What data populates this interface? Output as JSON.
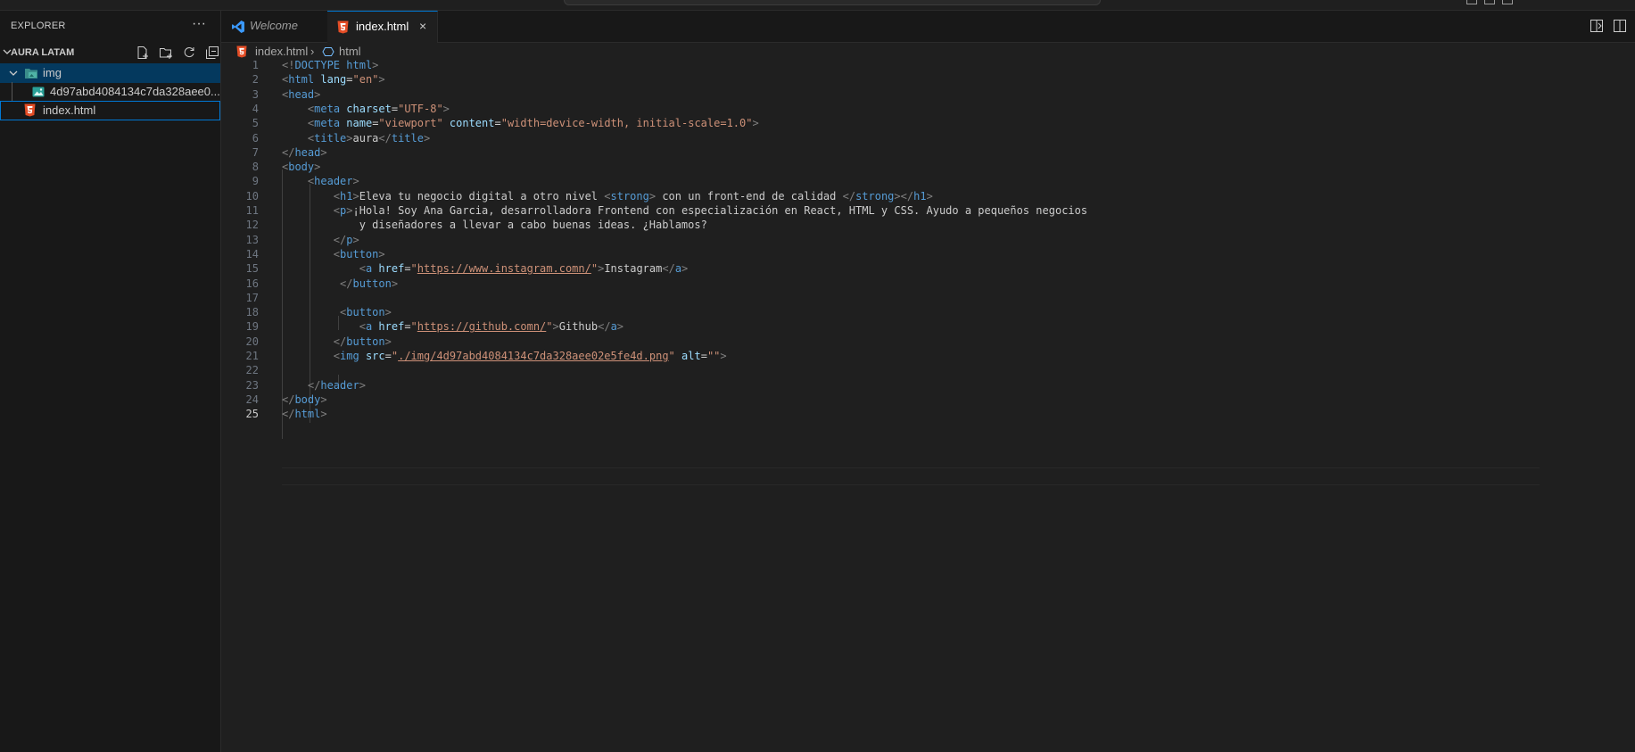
{
  "sidebar": {
    "header": "EXPLORER",
    "more_label": "···",
    "section_title": "AURA LATAM",
    "tree": [
      {
        "label": "img",
        "type": "folder",
        "expanded": true
      },
      {
        "label": "4d97abd4084134c7da328aee0...",
        "type": "image"
      },
      {
        "label": "index.html",
        "type": "html"
      }
    ]
  },
  "tabs": [
    {
      "label": "Welcome",
      "active": false
    },
    {
      "label": "index.html",
      "active": true,
      "close": "×"
    }
  ],
  "breadcrumb": {
    "file": "index.html",
    "separator": "›",
    "symbol": "html"
  },
  "editor": {
    "current_line": 25,
    "lines": [
      {
        "n": "1"
      },
      {
        "n": "2"
      },
      {
        "n": "3"
      },
      {
        "n": "4"
      },
      {
        "n": "5"
      },
      {
        "n": "6"
      },
      {
        "n": "7"
      },
      {
        "n": "8"
      },
      {
        "n": "9"
      },
      {
        "n": "10"
      },
      {
        "n": "11"
      },
      {
        "n": "12"
      },
      {
        "n": "13"
      },
      {
        "n": "14"
      },
      {
        "n": "15"
      },
      {
        "n": "16"
      },
      {
        "n": "17"
      },
      {
        "n": "18"
      },
      {
        "n": "19"
      },
      {
        "n": "20"
      },
      {
        "n": "21"
      },
      {
        "n": "22"
      },
      {
        "n": "23"
      },
      {
        "n": "24"
      },
      {
        "n": "25"
      }
    ],
    "code": [
      "<!DOCTYPE html>",
      "<html lang=\"en\">",
      "<head>",
      "    <meta charset=\"UTF-8\">",
      "    <meta name=\"viewport\" content=\"width=device-width, initial-scale=1.0\">",
      "    <title>aura</title>",
      "</head>",
      "<body>",
      "    <header>",
      "        <h1>Eleva tu negocio digital a otro nivel <strong> con un front-end de calidad </strong></h1>",
      "        <p>¡Hola! Soy Ana Garcia, desarrolladora Frontend con especialización en React, HTML y CSS. Ayudo a pequeños negocios",
      "            y diseñadores a llevar a cabo buenas ideas. ¿Hablamos?",
      "        </p>",
      "        <button>",
      "            <a href=\"https://www.instagram.comn/\">Instagram</a>",
      "         </button>",
      "",
      "         <button>",
      "            <a href=\"https://github.comn/\">Github</a>",
      "        </button>",
      "        <img src=\"./img/4d97abd4084134c7da328aee02e5fe4d.png\" alt=\"\">",
      "",
      "    </header>",
      "</body>",
      "</html>"
    ]
  },
  "colors": {
    "accent": "#0078d4",
    "html_icon": "#e44d26",
    "folder_icon": "#4fb3a7",
    "tag": "#569cd6",
    "attr": "#9cdcfe",
    "string": "#ce9178"
  }
}
